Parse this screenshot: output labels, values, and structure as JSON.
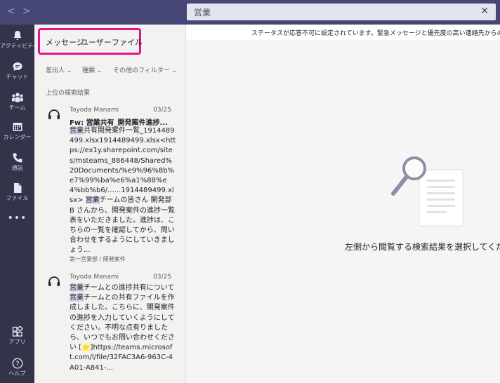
{
  "nav": {
    "back": "<",
    "forward": ">"
  },
  "search": {
    "query": "営業",
    "clear": "✕"
  },
  "rail": [
    {
      "label": "アクティビティ",
      "icon": "bell-icon"
    },
    {
      "label": "チャット",
      "icon": "chat-icon"
    },
    {
      "label": "チーム",
      "icon": "teams-icon"
    },
    {
      "label": "カレンダー",
      "icon": "calendar-icon"
    },
    {
      "label": "通話",
      "icon": "phone-icon"
    },
    {
      "label": "ファイル",
      "icon": "file-icon"
    },
    {
      "label": "",
      "icon": "more-icon"
    }
  ],
  "rail_bottom": [
    {
      "label": "アプリ",
      "icon": "apps-icon"
    },
    {
      "label": "ヘルプ",
      "icon": "help-icon"
    }
  ],
  "tabs": {
    "messages": "メッセージ",
    "users": "ユーザー",
    "files": "ファイル"
  },
  "filters": {
    "sender": "差出人",
    "type": "種類",
    "other": "その他のフィルター"
  },
  "section_title": "上位の検索結果",
  "results": [
    {
      "sender": "Toyoda Manami",
      "date": "03/25",
      "subject_prefix": "Fw: ",
      "subject_hl": "営業",
      "subject_rest": "共有_開発案件進捗...",
      "body_hl1": "営業",
      "body_mid": "共有開発案件一覧_1914489499.xlsx1914489499.xlsx<https://ex1y.sharepoint.com/sites/msteams_886448/Shared%20Documents/%e9%96%8b%e7%99%ba%e6%a1%88%e4%bb%b6/......1914489499.xlsx> ",
      "body_hl2": "営業",
      "body_rest": "チームの皆さん 開発部 B さんから、開発案件の進捗一覧表をいただきました。進捗は、こちらの一覧を確認してから、問い合わせをするようにしていきましょう...",
      "meta": "第一営業部 / 開発案件"
    },
    {
      "sender": "Toyoda Manami",
      "date": "03/25",
      "subject_hl": "営業",
      "subject_rest": "チームとの進捗共有について",
      "body_hl1": "営業",
      "body_mid": "チームとの共有ファイルを作成しました。こちらに、開発案件の進捗を入力していくようにしてください。不明な点有りましたら、いつでもお問い合わせください [",
      "star": "⭐",
      "body_rest": "]https://teams.microsoft.com/l/file/32FAC3A6-963C-4A01-A841-..."
    }
  ],
  "status_text": "ステータスが応答不可に設定されています。緊急メッセージと優先度の高い連絡先からの通知のみ表示",
  "empty_state": "左側から閲覧する検索結果を選択してください"
}
